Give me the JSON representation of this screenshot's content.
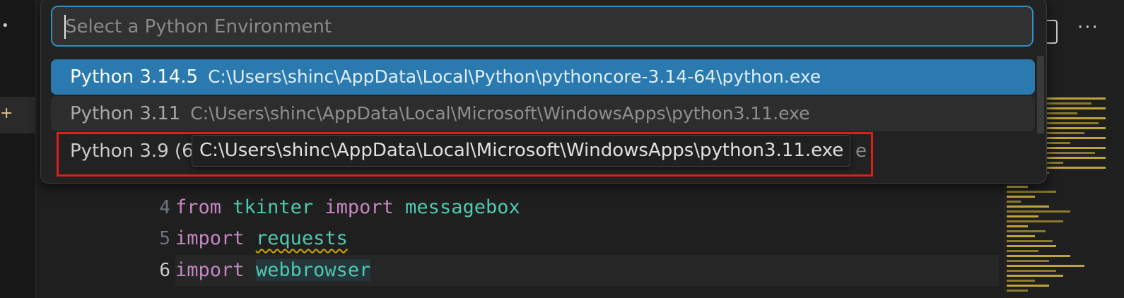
{
  "quick_pick": {
    "placeholder": "Select a Python Environment",
    "items": [
      {
        "label": "Python 3.14.5",
        "description": "C:\\Users\\shinc\\AppData\\Local\\Python\\pythoncore-3.14-64\\python.exe",
        "state": "selected"
      },
      {
        "label": "Python 3.11",
        "description": "C:\\Users\\shinc\\AppData\\Local\\Microsoft\\WindowsApps\\python3.11.exe",
        "state": "hover"
      },
      {
        "label": "Python 3.9 (6",
        "description": "",
        "tail": "e",
        "state": "plain"
      }
    ]
  },
  "tooltip": {
    "text": "C:\\Users\\shinc\\AppData\\Local\\Microsoft\\WindowsApps\\python3.11.exe"
  },
  "editor": {
    "lines": [
      {
        "number": "4",
        "tokens": [
          {
            "text": "from",
            "kind": "keyword"
          },
          {
            "text": " "
          },
          {
            "text": "tkinter",
            "kind": "module"
          },
          {
            "text": " "
          },
          {
            "text": "import",
            "kind": "keyword"
          },
          {
            "text": " "
          },
          {
            "text": "messagebox",
            "kind": "module"
          }
        ]
      },
      {
        "number": "5",
        "tokens": [
          {
            "text": "import",
            "kind": "keyword"
          },
          {
            "text": " "
          },
          {
            "text": "requests",
            "kind": "module-warn"
          }
        ]
      },
      {
        "number": "6",
        "tokens": [
          {
            "text": "import",
            "kind": "keyword"
          },
          {
            "text": " "
          },
          {
            "text": "webbrowser",
            "kind": "module-hl"
          }
        ]
      }
    ]
  },
  "icons": {
    "overflow": "more-actions-icon",
    "split": "split-editor-icon",
    "activity_dot": "more-icon",
    "activity_plus": "new-file-icon"
  },
  "colors": {
    "accent": "#2a7ab0",
    "focus_border": "#2f8fbf",
    "annotation": "#e21b1b",
    "keyword": "#c586c0",
    "module": "#4ec9b0",
    "warning": "#cca700"
  }
}
